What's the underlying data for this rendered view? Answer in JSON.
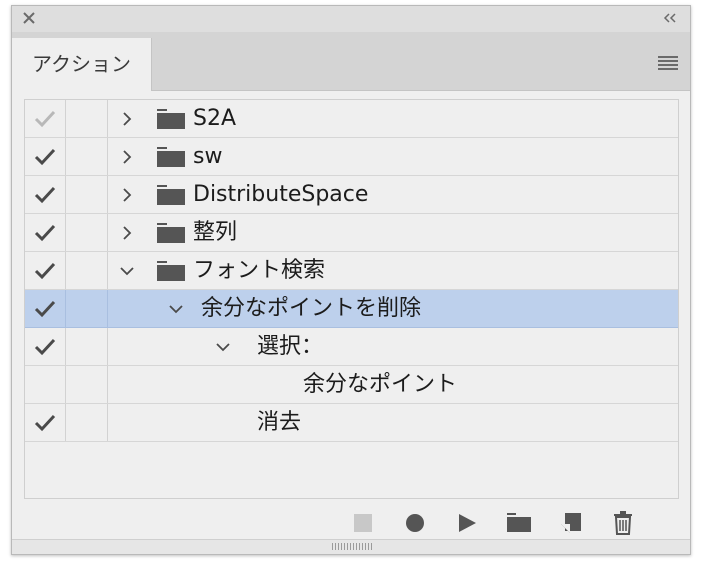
{
  "panel": {
    "tab_label": "アクション"
  },
  "rows": [
    {
      "label": "S2A",
      "checked": true,
      "check_dim": true,
      "expanded": false,
      "type": "set"
    },
    {
      "label": "sw",
      "checked": true,
      "expanded": false,
      "type": "set"
    },
    {
      "label": "DistributeSpace",
      "checked": true,
      "expanded": false,
      "type": "set"
    },
    {
      "label": "整列",
      "checked": true,
      "expanded": false,
      "type": "set"
    },
    {
      "label": "フォント検索",
      "checked": true,
      "expanded": true,
      "type": "set"
    },
    {
      "label": "余分なポイントを削除",
      "checked": true,
      "expanded": true,
      "type": "action",
      "selected": true
    },
    {
      "label": "選択：",
      "checked": true,
      "expanded": true,
      "type": "command"
    },
    {
      "label": "余分なポイント",
      "checked": false,
      "type": "detail"
    },
    {
      "label": "消去",
      "checked": true,
      "type": "command"
    }
  ],
  "toolbar": {
    "buttons": [
      "stop-icon",
      "record-icon",
      "play-icon",
      "new-set-icon",
      "new-action-icon",
      "delete-icon"
    ]
  },
  "colors": {
    "selection": "#bdd0ec",
    "check": "#4a4a4a",
    "check_dim": "#b8b8b8",
    "icon": "#555555"
  }
}
